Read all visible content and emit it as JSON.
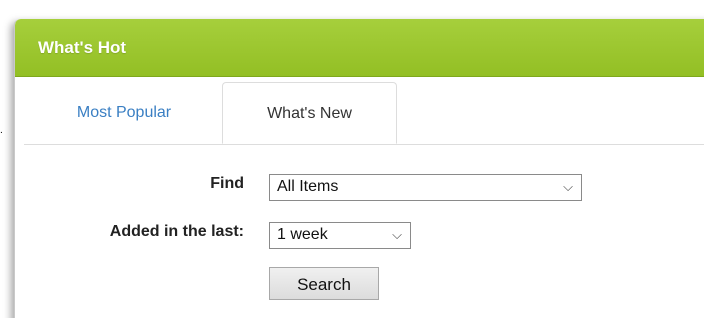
{
  "panel": {
    "title": "What's Hot"
  },
  "tabs": [
    {
      "label": "Most Popular",
      "active": false
    },
    {
      "label": "What's New",
      "active": true
    }
  ],
  "form": {
    "find_label": "Find",
    "find_value": "All Items",
    "added_label": "Added in the last:",
    "added_value": "1 week",
    "search_label": "Search"
  },
  "icons": {
    "dropdown": "chevron-down-icon"
  },
  "colors": {
    "header_green": "#9cc82f",
    "link_blue": "#3a7fc3"
  }
}
